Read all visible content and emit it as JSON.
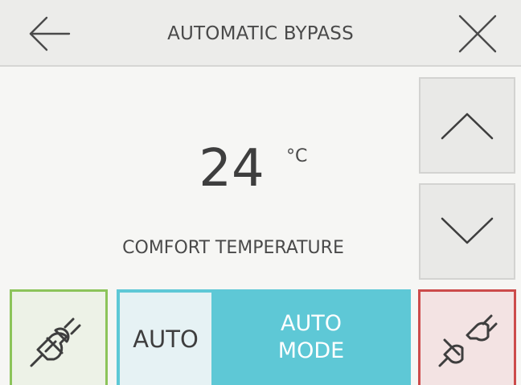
{
  "header": {
    "title": "AUTOMATIC BYPASS",
    "back_icon": "arrow-left-icon",
    "close_icon": "close-icon"
  },
  "temperature": {
    "value": "24",
    "unit": "°C",
    "label": "COMFORT TEMPERATURE"
  },
  "controls": {
    "up_icon": "chevron-up-icon",
    "down_icon": "chevron-down-icon"
  },
  "mode_toggle": {
    "left_label": "AUTO",
    "right_line1": "AUTO",
    "right_line2": "MODE"
  },
  "plugs": {
    "left_icon": "plug-connected-icon",
    "right_icon": "plug-disconnected-icon"
  },
  "colors": {
    "connected": "#8cc45a",
    "disconnected": "#cc4b4b",
    "mode_accent": "#5ec8d6"
  }
}
